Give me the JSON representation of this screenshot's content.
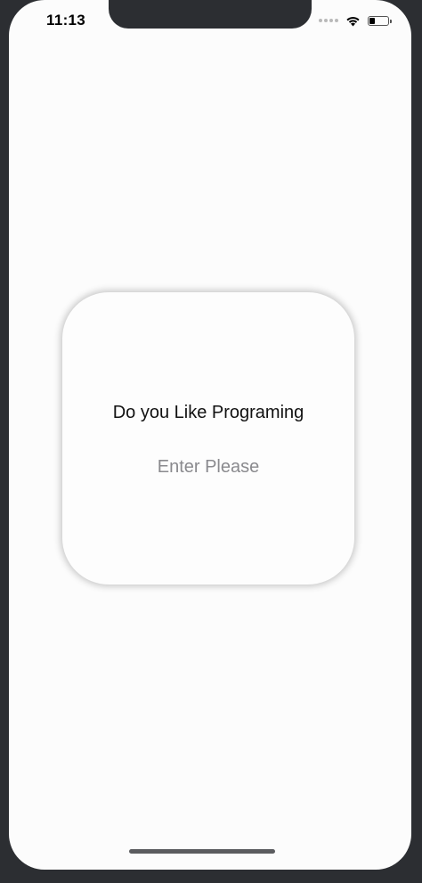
{
  "status_bar": {
    "time": "11:13",
    "battery_level": 0.3,
    "icons": [
      "signal-dots-icon",
      "wifi-icon",
      "battery-icon"
    ]
  },
  "card": {
    "question": "Do you Like Programing",
    "input_value": "",
    "input_placeholder": "Enter Please"
  },
  "colors": {
    "screen_bg": "#fcfcfc",
    "device_frame": "#2c2e32",
    "placeholder": "#8a8a8e"
  }
}
